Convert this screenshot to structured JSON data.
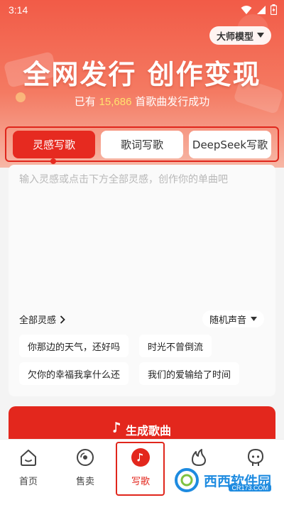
{
  "status_bar": {
    "time": "3:14"
  },
  "header": {
    "model_label": "大师模型",
    "headline": "全网发行 创作变现",
    "subtitle_prefix": "已有 ",
    "subtitle_count": "15,686",
    "subtitle_suffix": " 首歌曲发行成功"
  },
  "tabs": [
    {
      "label": "灵感写歌",
      "active": true
    },
    {
      "label": "歌词写歌",
      "active": false
    },
    {
      "label": "DeepSeek写歌",
      "active": false
    }
  ],
  "input": {
    "placeholder": "输入灵感或点击下方全部灵感，创作你的单曲吧"
  },
  "inspiration": {
    "all_label": "全部灵感",
    "voice_label": "随机声音",
    "chips": [
      "你那边的天气，还好吗",
      "时光不曾倒流",
      "欠你的幸福我拿什么还",
      "我们的爱输给了时间"
    ]
  },
  "generate_button": {
    "label": "生成歌曲"
  },
  "bottom_nav": {
    "items": [
      {
        "label": "首页",
        "icon": "home-icon"
      },
      {
        "label": "售卖",
        "icon": "vinyl-icon"
      },
      {
        "label": "写歌",
        "icon": "music-note-icon",
        "active": true
      },
      {
        "label": "",
        "icon": "flame-icon"
      },
      {
        "label": "",
        "icon": "profile-icon"
      }
    ]
  },
  "watermark": {
    "text": "西西软件园",
    "url": "CR173.COM"
  },
  "colors": {
    "accent": "#e3271d",
    "highlight_frame": "#e0261c",
    "count_color": "#ffe36e"
  }
}
